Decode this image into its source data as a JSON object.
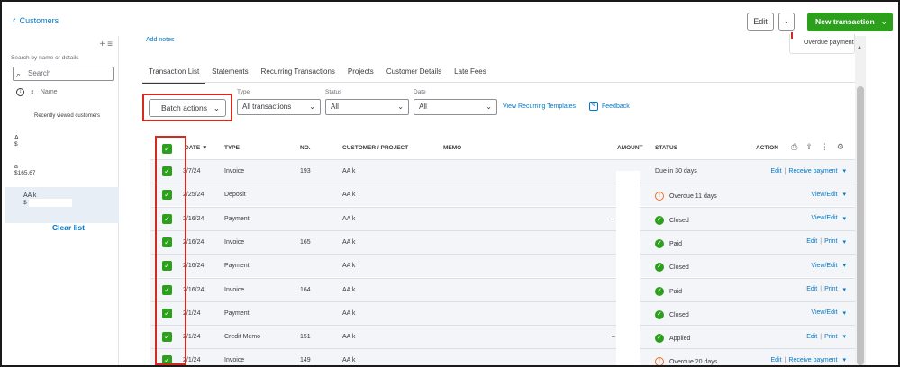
{
  "header": {
    "back_label": "Customers",
    "edit_label": "Edit",
    "new_transaction_label": "New transaction"
  },
  "sidebar": {
    "search_hint": "Search by name or details",
    "search_placeholder": "Search",
    "sort_label": "Name",
    "recent_label": "Recently viewed customers",
    "items": [
      {
        "name": "A",
        "sub": "$"
      },
      {
        "name": "a",
        "sub": "$165.67"
      },
      {
        "name": "AA k",
        "sub": "$"
      }
    ],
    "clear_list": "Clear list"
  },
  "main": {
    "add_notes": "Add notes",
    "overdue_card": "Overdue payment",
    "tabs": [
      "Transaction List",
      "Statements",
      "Recurring Transactions",
      "Projects",
      "Customer Details",
      "Late Fees"
    ],
    "filters": {
      "batch_actions": "Batch actions",
      "type_label": "Type",
      "type_value": "All transactions",
      "status_label": "Status",
      "status_value": "All",
      "date_label": "Date",
      "date_value": "All"
    },
    "view_recurring": "View Recurring Templates",
    "feedback": "Feedback"
  },
  "table": {
    "columns": {
      "date": "DATE ▼",
      "type": "TYPE",
      "no": "NO.",
      "customer": "CUSTOMER / PROJECT",
      "memo": "MEMO",
      "amount": "AMOUNT",
      "status": "STATUS",
      "action": "ACTION"
    },
    "rows": [
      {
        "date": "3/7/24",
        "type": "Invoice",
        "no": "193",
        "customer": "AA k",
        "status": "Due in 30 days",
        "status_icon": "none",
        "actions": [
          "Edit",
          "Receive payment"
        ],
        "amount_prefix": ""
      },
      {
        "date": "2/25/24",
        "type": "Deposit",
        "no": "",
        "customer": "AA k",
        "status": "Overdue 11 days",
        "status_icon": "warn",
        "actions": [
          "View/Edit"
        ],
        "amount_prefix": ""
      },
      {
        "date": "2/16/24",
        "type": "Payment",
        "no": "",
        "customer": "AA k",
        "status": "Closed",
        "status_icon": "ok",
        "actions": [
          "View/Edit"
        ],
        "amount_prefix": "–"
      },
      {
        "date": "2/16/24",
        "type": "Invoice",
        "no": "165",
        "customer": "AA k",
        "status": "Paid",
        "status_icon": "ok",
        "actions": [
          "Edit",
          "Print"
        ],
        "amount_prefix": ""
      },
      {
        "date": "2/16/24",
        "type": "Payment",
        "no": "",
        "customer": "AA k",
        "status": "Closed",
        "status_icon": "ok",
        "actions": [
          "View/Edit"
        ],
        "amount_prefix": ""
      },
      {
        "date": "2/16/24",
        "type": "Invoice",
        "no": "164",
        "customer": "AA k",
        "status": "Paid",
        "status_icon": "ok",
        "actions": [
          "Edit",
          "Print"
        ],
        "amount_prefix": ""
      },
      {
        "date": "2/1/24",
        "type": "Payment",
        "no": "",
        "customer": "AA k",
        "status": "Closed",
        "status_icon": "ok",
        "actions": [
          "View/Edit"
        ],
        "amount_prefix": ""
      },
      {
        "date": "2/1/24",
        "type": "Credit Memo",
        "no": "151",
        "customer": "AA k",
        "status": "Applied",
        "status_icon": "ok",
        "actions": [
          "Edit",
          "Print"
        ],
        "amount_prefix": "–"
      },
      {
        "date": "2/1/24",
        "type": "Invoice",
        "no": "149",
        "customer": "AA k",
        "status": "Overdue 20 days",
        "status_icon": "warn",
        "actions": [
          "Edit",
          "Receive payment"
        ],
        "amount_prefix": ""
      }
    ]
  },
  "colors": {
    "accent_green": "#2ca01c",
    "link_blue": "#0077c5",
    "highlight_red": "#d52b1e",
    "warn_orange": "#ec7224"
  }
}
